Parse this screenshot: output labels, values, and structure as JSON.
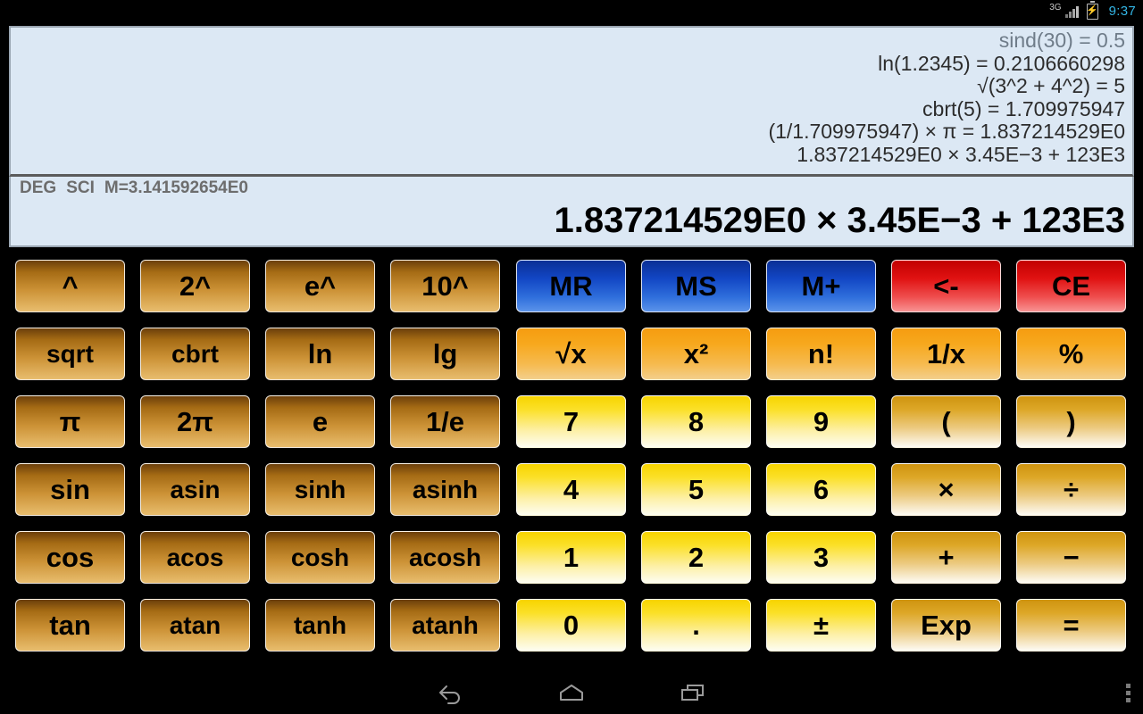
{
  "status_bar": {
    "network_label": "3G",
    "signal_icon": "signal-bars-icon",
    "battery_icon": "battery-charging-icon",
    "battery_glyph": "⚡",
    "time": "9:37",
    "accent_color": "#33b5e5"
  },
  "display": {
    "history": [
      "sind(30) = 0.5",
      "ln(1.2345) = 0.2106660298",
      "√(3^2 + 4^2) = 5",
      "cbrt(5) = 1.709975947",
      "(1/1.709975947) × π = 1.837214529E0",
      "1.837214529E0 × 3.45E−3 + 123E3"
    ],
    "mode_angle": "DEG",
    "mode_notation": "SCI",
    "memory": "M=3.141592654E0",
    "expression": "1.837214529E0 × 3.45E−3 + 123E3",
    "panel_color": "#dce8f4",
    "text_color": "#000000"
  },
  "keypad": {
    "rows": [
      [
        {
          "label": "^",
          "name": "key-power",
          "style": "func"
        },
        {
          "label": "2^",
          "name": "key-two-pow",
          "style": "func"
        },
        {
          "label": "e^",
          "name": "key-e-pow",
          "style": "func"
        },
        {
          "label": "10^",
          "name": "key-ten-pow",
          "style": "func"
        },
        {
          "label": "MR",
          "name": "key-memory-recall",
          "style": "mem"
        },
        {
          "label": "MS",
          "name": "key-memory-store",
          "style": "mem"
        },
        {
          "label": "M+",
          "name": "key-memory-add",
          "style": "mem"
        },
        {
          "label": "<-",
          "name": "key-backspace",
          "style": "clear"
        },
        {
          "label": "CE",
          "name": "key-clear-entry",
          "style": "clear"
        }
      ],
      [
        {
          "label": "sqrt",
          "name": "key-sqrt-func",
          "style": "func"
        },
        {
          "label": "cbrt",
          "name": "key-cbrt-func",
          "style": "func"
        },
        {
          "label": "ln",
          "name": "key-ln",
          "style": "func"
        },
        {
          "label": "lg",
          "name": "key-lg",
          "style": "func"
        },
        {
          "label": "√x",
          "name": "key-sqrt",
          "style": "orange"
        },
        {
          "label": "x²",
          "name": "key-square",
          "style": "orange"
        },
        {
          "label": "n!",
          "name": "key-factorial",
          "style": "orange"
        },
        {
          "label": "1/x",
          "name": "key-reciprocal",
          "style": "orange"
        },
        {
          "label": "%",
          "name": "key-percent",
          "style": "orange"
        }
      ],
      [
        {
          "label": "π",
          "name": "key-pi",
          "style": "func"
        },
        {
          "label": "2π",
          "name": "key-two-pi",
          "style": "func"
        },
        {
          "label": "e",
          "name": "key-euler",
          "style": "func"
        },
        {
          "label": "1/e",
          "name": "key-inverse-e",
          "style": "func"
        },
        {
          "label": "7",
          "name": "key-7",
          "style": "num"
        },
        {
          "label": "8",
          "name": "key-8",
          "style": "num"
        },
        {
          "label": "9",
          "name": "key-9",
          "style": "num"
        },
        {
          "label": "(",
          "name": "key-paren-open",
          "style": "op"
        },
        {
          "label": ")",
          "name": "key-paren-close",
          "style": "op"
        }
      ],
      [
        {
          "label": "sin",
          "name": "key-sin",
          "style": "func"
        },
        {
          "label": "asin",
          "name": "key-asin",
          "style": "func"
        },
        {
          "label": "sinh",
          "name": "key-sinh",
          "style": "func"
        },
        {
          "label": "asinh",
          "name": "key-asinh",
          "style": "func"
        },
        {
          "label": "4",
          "name": "key-4",
          "style": "num"
        },
        {
          "label": "5",
          "name": "key-5",
          "style": "num"
        },
        {
          "label": "6",
          "name": "key-6",
          "style": "num"
        },
        {
          "label": "×",
          "name": "key-multiply",
          "style": "op"
        },
        {
          "label": "÷",
          "name": "key-divide",
          "style": "op"
        }
      ],
      [
        {
          "label": "cos",
          "name": "key-cos",
          "style": "func"
        },
        {
          "label": "acos",
          "name": "key-acos",
          "style": "func"
        },
        {
          "label": "cosh",
          "name": "key-cosh",
          "style": "func"
        },
        {
          "label": "acosh",
          "name": "key-acosh",
          "style": "func"
        },
        {
          "label": "1",
          "name": "key-1",
          "style": "num"
        },
        {
          "label": "2",
          "name": "key-2",
          "style": "num"
        },
        {
          "label": "3",
          "name": "key-3",
          "style": "num"
        },
        {
          "label": "+",
          "name": "key-add",
          "style": "op"
        },
        {
          "label": "−",
          "name": "key-subtract",
          "style": "op"
        }
      ],
      [
        {
          "label": "tan",
          "name": "key-tan",
          "style": "func"
        },
        {
          "label": "atan",
          "name": "key-atan",
          "style": "func"
        },
        {
          "label": "tanh",
          "name": "key-tanh",
          "style": "func"
        },
        {
          "label": "atanh",
          "name": "key-atanh",
          "style": "func"
        },
        {
          "label": "0",
          "name": "key-0",
          "style": "num"
        },
        {
          "label": ".",
          "name": "key-decimal",
          "style": "num"
        },
        {
          "label": "±",
          "name": "key-sign-toggle",
          "style": "num"
        },
        {
          "label": "Exp",
          "name": "key-exponent",
          "style": "op"
        },
        {
          "label": "=",
          "name": "key-equals",
          "style": "op"
        }
      ]
    ]
  },
  "nav_bar": {
    "back_icon": "back-arrow-icon",
    "home_icon": "home-icon",
    "recents_icon": "recent-apps-icon",
    "overflow_icon": "overflow-menu-icon"
  }
}
